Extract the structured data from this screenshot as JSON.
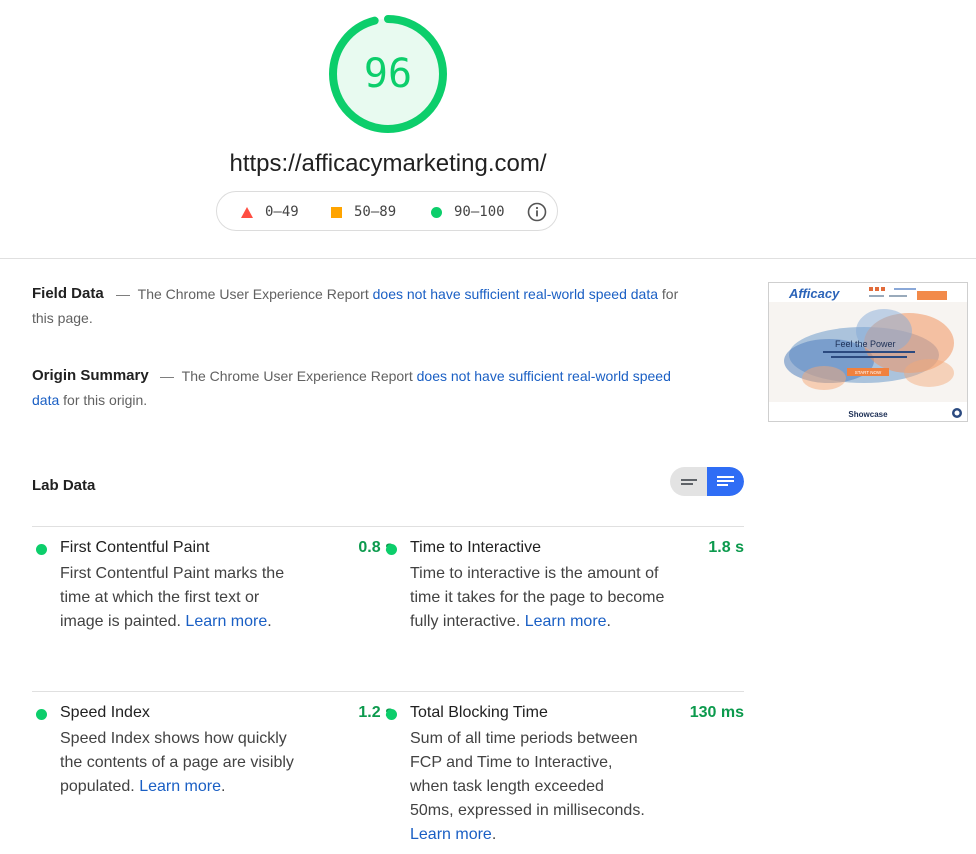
{
  "score": {
    "value": "96",
    "fraction": 0.96,
    "color": "#0cce6b"
  },
  "url": "https://afficacymarketing.com/",
  "legend": {
    "fail": "0–49",
    "average": "50–89",
    "pass": "90–100"
  },
  "field_data": {
    "title": "Field Data",
    "text_before": "The Chrome User Experience Report",
    "link": "does not have sufficient real-world speed data",
    "text_after": "for this page."
  },
  "origin_summary": {
    "title": "Origin Summary",
    "text_before": "The Chrome User Experience Report",
    "link": "does not have sufficient real-world speed data",
    "text_after": "for this origin."
  },
  "thumbnail": {
    "brand": "Afficacy",
    "button": "START NOW",
    "headline": "Feel the Power",
    "caption": "Showcase"
  },
  "lab_data": {
    "title": "Lab Data",
    "learn_more": "Learn more",
    "metrics": [
      {
        "name": "First Contentful Paint",
        "value": "0.8 s",
        "desc": "First Contentful Paint marks the time at which the first text or image is painted."
      },
      {
        "name": "Time to Interactive",
        "value": "1.8 s",
        "desc": "Time to interactive is the amount of time it takes for the page to become fully interactive."
      },
      {
        "name": "Speed Index",
        "value": "1.2 s",
        "desc": "Speed Index shows how quickly the contents of a page are visibly populated."
      },
      {
        "name": "Total Blocking Time",
        "value": "130 ms",
        "desc": "Sum of all time periods between FCP and Time to Interactive, when task length exceeded 50ms, expressed in milliseconds."
      }
    ]
  }
}
